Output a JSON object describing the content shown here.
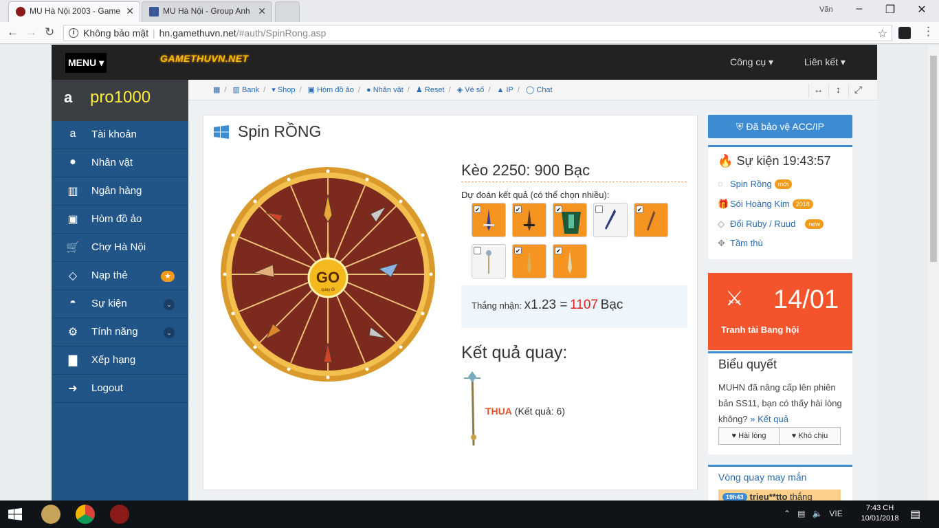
{
  "browser": {
    "tabs": [
      {
        "title": "MU Hà Nội 2003 - Game",
        "active": true
      },
      {
        "title": "MU Hà Nội - Group Anh",
        "active": false
      }
    ],
    "user": "Văn",
    "security_label": "Không bảo mật",
    "url_host": "hn.gamethuvn.net",
    "url_path": "/#auth/SpinRong.asp"
  },
  "topnav": {
    "menu_label": "MENU",
    "logo_text": "GAMETHUVN.NET",
    "tools_label": "Công cụ",
    "links_label": "Liên kết"
  },
  "sidebar": {
    "username": "pro1000",
    "items": [
      {
        "label": "Tài khoản",
        "icon": "amazon-icon"
      },
      {
        "label": "Nhân vật",
        "icon": "user-icon"
      },
      {
        "label": "Ngân hàng",
        "icon": "bank-icon"
      },
      {
        "label": "Hòm đồ ảo",
        "icon": "briefcase-icon"
      },
      {
        "label": "Chợ Hà Nội",
        "icon": "cart-icon"
      },
      {
        "label": "Nạp thẻ",
        "icon": "diamond-icon",
        "badge": "★"
      },
      {
        "label": "Sự kiện",
        "icon": "android-icon",
        "chevron": "⌄"
      },
      {
        "label": "Tính năng",
        "icon": "cogs-icon",
        "chevron": "⌄"
      },
      {
        "label": "Xếp hạng",
        "icon": "bar-chart-icon"
      },
      {
        "label": "Logout",
        "icon": "sign-out-icon"
      }
    ]
  },
  "breadcrumb": [
    "Bank",
    "Shop",
    "Hòm đồ ảo",
    "Nhân vật",
    "Reset",
    "Vé số",
    "IP",
    "Chat"
  ],
  "main": {
    "title": "Spin RỒNG",
    "wheel_go": "GO",
    "wheel_sub": "quay đi",
    "keo": "Kèo 2250: 900 Bạc",
    "predict_label": "Dự đoán kết quả (có thể chọn nhiều):",
    "items": [
      {
        "checked": true
      },
      {
        "checked": true
      },
      {
        "checked": true
      },
      {
        "checked": false
      },
      {
        "checked": true
      },
      {
        "checked": false
      },
      {
        "checked": true
      },
      {
        "checked": true
      }
    ],
    "win_label": "Thắng nhận:",
    "win_mult": "x1.23 =",
    "win_amount": "1107",
    "win_unit": "Bạc",
    "result_label": "Kết quả quay:",
    "result_status": "THUA",
    "result_detail": "(Kết quả: 6)"
  },
  "right": {
    "protect_label": "Đã bảo vệ ACC/IP",
    "events_title": "Sự kiện 19:43:57",
    "events": [
      {
        "label": "Spin Rồng",
        "badge": "mới",
        "icon": "spinner-icon"
      },
      {
        "label": "Sói Hoàng Kim",
        "badge": "2018",
        "icon": "gift-icon"
      },
      {
        "label": "Đổi Ruby / Ruud",
        "badge": "new",
        "icon": "diamond-icon"
      },
      {
        "label": "Tầm thù",
        "badge": "",
        "icon": "crosshair-icon"
      }
    ],
    "tourney_date": "14/01",
    "tourney_label": "Tranh tài Bang hội",
    "poll_title": "Biểu quyết",
    "poll_question": "MUHN đã nâng cấp lên phiên bản SS11, bạn có thấy hài lòng không?",
    "poll_link": "» Kết quả",
    "poll_yes": "Hài lòng",
    "poll_no": "Khó chịu",
    "lucky_title": "Vòng quay may mắn",
    "lucky_time": "19h43",
    "lucky_user": "trieu**tto",
    "lucky_action": "thắng"
  },
  "taskbar": {
    "lang": "VIE",
    "time": "7:43 CH",
    "date": "10/01/2018"
  },
  "colors": {
    "sidebar": "#215487",
    "accent": "#3d8bd1",
    "item_orange": "#f59420",
    "tourney": "#f3542c"
  }
}
